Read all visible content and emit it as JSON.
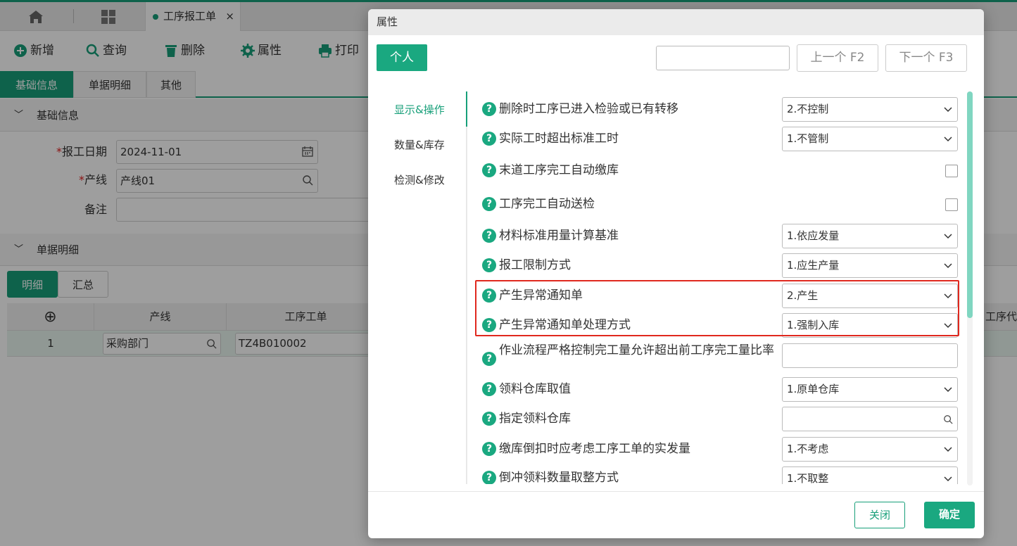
{
  "tabs": {
    "active_tab": "工序报工单",
    "close": "×"
  },
  "toolbar": {
    "add": "新增",
    "query": "查询",
    "delete": "删除",
    "properties": "属性",
    "print": "打印"
  },
  "subtabs": [
    "基础信息",
    "单据明细",
    "其他"
  ],
  "section_basic": "基础信息",
  "form": {
    "date_label": "报工日期",
    "date_value": "2024-11-01",
    "line_label": "产线",
    "line_value": "产线01",
    "note_label": "备注",
    "required_mark": "*"
  },
  "section_detail": "单据明细",
  "detail_tabs": [
    "明细",
    "汇总"
  ],
  "table": {
    "add_symbol": "⊕",
    "headers": [
      "产线",
      "工序工单",
      "工序代"
    ],
    "row": {
      "index": "1",
      "line": "采购部门",
      "order": "TZ4B010002"
    }
  },
  "modal": {
    "title": "属性",
    "personal": "个人",
    "search_value": "",
    "prev": "上一个 F2",
    "next": "下一个 F3",
    "side_items": [
      "显示&操作",
      "数量&库存",
      "检测&修改"
    ],
    "help_icon": "?",
    "props": [
      {
        "label": "删除时工序已进入检验或已有转移",
        "value": "2.不控制"
      },
      {
        "label": "实际工时超出标准工时",
        "value": "1.不管制"
      },
      {
        "label": "末道工序完工自动缴库",
        "checked": false
      },
      {
        "label": "工序完工自动送检",
        "checked": false
      },
      {
        "label": "材料标准用量计算基准",
        "value": "1.依应发量"
      },
      {
        "label": "报工限制方式",
        "value": "1.应生产量"
      },
      {
        "label": "产生异常通知单",
        "value": "2.产生"
      },
      {
        "label": "产生异常通知单处理方式",
        "value": "1.强制入库"
      },
      {
        "label": "作业流程严格控制完工量允许超出前工序完工量比率",
        "value": ""
      },
      {
        "label": "领料仓库取值",
        "value": "1.原单仓库"
      },
      {
        "label": "指定领料仓库",
        "value": ""
      },
      {
        "label": "缴库倒扣时应考虑工序工单的实发量",
        "value": "1.不考虑"
      },
      {
        "label": "倒冲领料数量取整方式",
        "value": "1.不取整"
      }
    ],
    "close": "关闭",
    "confirm": "确定"
  },
  "colors": {
    "accent": "#179f79",
    "highlight_box": "#e0281e"
  }
}
